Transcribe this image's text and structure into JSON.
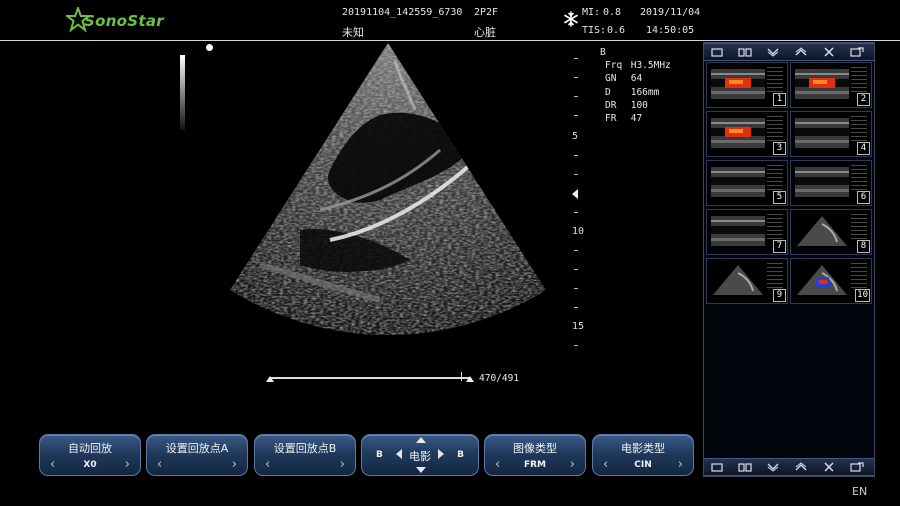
{
  "header": {
    "brand": "SonoStar",
    "study_id": "20191104_142559_6730",
    "probe": "2P2F",
    "patient_name": "未知",
    "exam": "心脏",
    "mi_label": "MI:",
    "mi_value": "0.8",
    "tis_label": "TIS:",
    "tis_value": "0.6",
    "date": "2019/11/04",
    "time": "14:50:05",
    "freeze_icon": "snowflake-icon"
  },
  "params": {
    "mode": "B",
    "rows": [
      {
        "k": "Frq",
        "v": "H3.5MHz"
      },
      {
        "k": "GN",
        "v": "64"
      },
      {
        "k": "D",
        "v": "166mm"
      },
      {
        "k": "DR",
        "v": "100"
      },
      {
        "k": "FR",
        "v": "47"
      }
    ]
  },
  "depth_scale": {
    "labels": [
      "5",
      "10",
      "15"
    ],
    "max": 16.6
  },
  "cine": {
    "current_frame": 470,
    "total_frames": 491,
    "counter": "470/491"
  },
  "thumbnail_toolbar_icons": [
    "single-layout-icon",
    "dual-layout-icon",
    "scroll-down-icon",
    "scroll-up-icon",
    "delete-icon",
    "export-icon"
  ],
  "thumbnails": [
    {
      "num": "1",
      "kind": "color"
    },
    {
      "num": "2",
      "kind": "color"
    },
    {
      "num": "3",
      "kind": "color"
    },
    {
      "num": "4",
      "kind": "linear"
    },
    {
      "num": "5",
      "kind": "linear"
    },
    {
      "num": "6",
      "kind": "linear"
    },
    {
      "num": "7",
      "kind": "linear"
    },
    {
      "num": "8",
      "kind": "sector"
    },
    {
      "num": "9",
      "kind": "sector"
    },
    {
      "num": "10",
      "kind": "sector-color"
    }
  ],
  "controls": {
    "auto_replay": {
      "label": "自动回放",
      "value": "X0"
    },
    "set_point_a": {
      "label": "设置回放点A",
      "value": ""
    },
    "set_point_b": {
      "label": "设置回放点B",
      "value": ""
    },
    "cine_control": {
      "label": "电影",
      "left": "B",
      "right": "B"
    },
    "image_type": {
      "label": "图像类型",
      "value": "FRM"
    },
    "cine_type": {
      "label": "电影类型",
      "value": "CIN"
    }
  },
  "language": "EN",
  "colors": {
    "accent": "#203a5e",
    "logo": "#6cc04a",
    "doppler_red": "#e03010"
  }
}
